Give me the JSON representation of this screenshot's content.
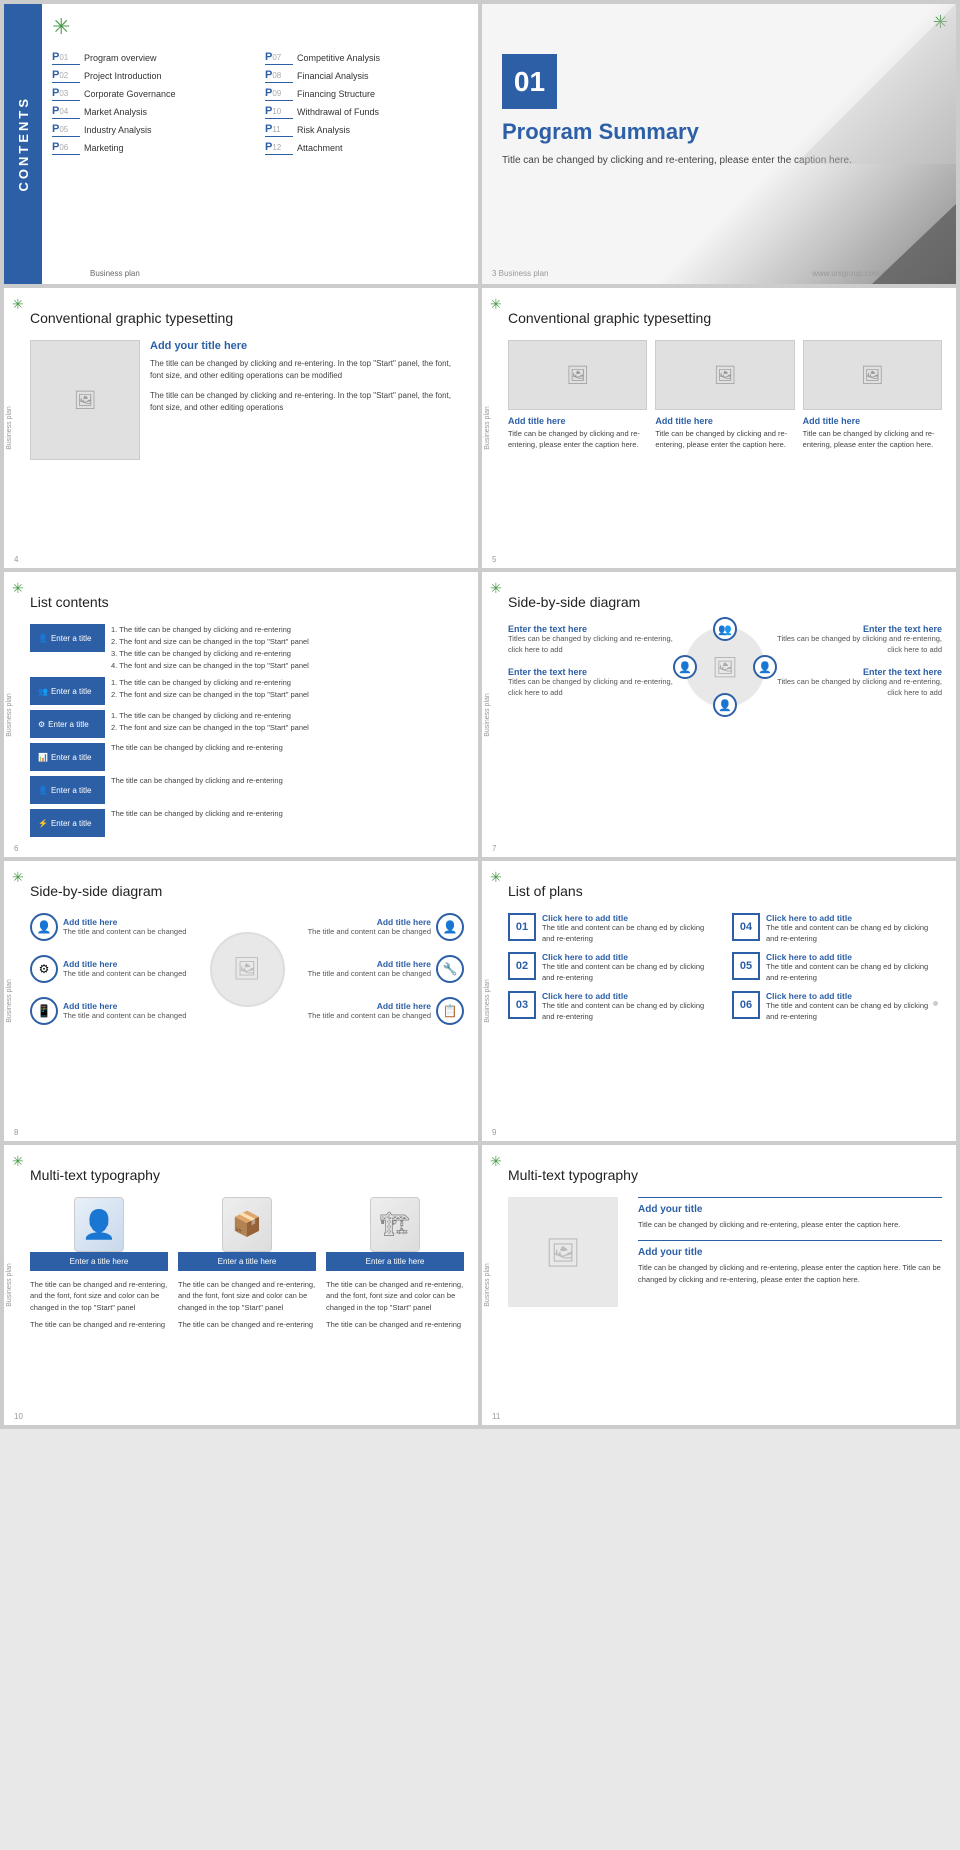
{
  "slides": {
    "contents": {
      "sidebar_label": "CONTENTS",
      "logo": "✳",
      "items": [
        {
          "num": "P01",
          "label": "Program overview"
        },
        {
          "num": "P07",
          "label": "Competitive Analysis"
        },
        {
          "num": "P02",
          "label": "Project Introduction"
        },
        {
          "num": "P08",
          "label": "Financial Analysis"
        },
        {
          "num": "P03",
          "label": "Corporate Governance"
        },
        {
          "num": "P09",
          "label": "Financing Structure"
        },
        {
          "num": "P04",
          "label": "Market Analysis"
        },
        {
          "num": "P10",
          "label": "Withdrawal of Funds"
        },
        {
          "num": "P05",
          "label": "Industry Analysis"
        },
        {
          "num": "P11",
          "label": "Risk Analysis"
        },
        {
          "num": "P06",
          "label": "Marketing"
        },
        {
          "num": "P12",
          "label": "Attachment"
        }
      ],
      "footer": "Business plan"
    },
    "summary": {
      "logo": "✳",
      "num": "01",
      "title": "Program Summary",
      "desc": "Title can be changed by clicking and re-entering, please enter the caption here.",
      "footer_left": "3  Business plan",
      "footer_right": "www.unigroup.com theme information"
    },
    "cgt_left": {
      "title": "Conventional graphic typesetting",
      "heading": "Add your title here",
      "body1": "The title can be changed by clicking and re-entering. In the top \"Start\" panel, the font, font size, and other editing operations can be modified",
      "body2": "The title can be changed by clicking and re-entering. In the top \"Start\" panel, the font, font size, and other editing operations",
      "page_num": "4",
      "side_label": "Business plan"
    },
    "cgt_right": {
      "title": "Conventional graphic typesetting",
      "cols": [
        {
          "heading": "Add title here",
          "body": "Title can be changed by clicking and re-entering, please enter the caption here."
        },
        {
          "heading": "Add title here",
          "body": "Title can be changed by clicking and re-entering, please enter the caption here."
        },
        {
          "heading": "Add title here",
          "body": "Title can be changed by clicking and re-entering, please enter the caption here."
        }
      ],
      "page_num": "5",
      "side_label": "Business plan"
    },
    "list_contents": {
      "title": "List contents",
      "items": [
        {
          "icon": "👤",
          "label": "Enter a title",
          "bullet_items": [
            "The title can be changed by clicking and re-entering",
            "The font and size can be changed in the top \"Start\" panel",
            "The title can be changed by clicking and re-entering",
            "The font and size can be changed in the top \"Start\" panel"
          ]
        },
        {
          "icon": "👥",
          "label": "Enter a title",
          "bullet_items": [
            "The title can be changed by clicking and re-entering",
            "The font and size can be changed in the top \"Start\" panel"
          ]
        },
        {
          "icon": "⚙",
          "label": "Enter a title",
          "bullet_items": [
            "The title can be changed by clicking and re-entering",
            "The font and size can be changed in the top \"Start\" panel"
          ]
        },
        {
          "icon": "📊",
          "label": "Enter a title",
          "simple_text": "The title can be changed by clicking and re-entering"
        },
        {
          "icon": "👤",
          "label": "Enter a title",
          "simple_text": "The title can be changed by clicking and re-entering"
        },
        {
          "icon": "⚡",
          "label": "Enter a title",
          "simple_text": "The title can be changed by clicking and re-entering"
        }
      ],
      "page_num": "6",
      "side_label": "Business plan"
    },
    "sbs_left": {
      "title": "Side-by-side diagram",
      "items": [
        {
          "icon": "👥",
          "title": "Enter the text here",
          "desc": "Titles can be changed by clicking and re-entering, click here to add"
        },
        {
          "icon": "👤",
          "title": "Enter the text here",
          "desc": "Titles can be changed by clicking and re-entering, click here to add"
        },
        {
          "icon": "👤",
          "title": "Enter the text here",
          "desc": "Titles can be changed by clicking and re-entering, click here to add"
        },
        {
          "icon": "👤",
          "title": "Enter the text here",
          "desc": "Titles can be changed by clicking and re-entering, click here to add"
        }
      ],
      "page_num": "7",
      "side_label": "Business plan"
    },
    "sbs_right": {
      "title": "Side-by-side diagram",
      "left_items": [
        {
          "title": "Add title here",
          "desc": "The title and content can be changed"
        },
        {
          "title": "Add title here",
          "desc": "The title and content can be changed"
        },
        {
          "title": "Add title here",
          "desc": "The title and content can be changed"
        }
      ],
      "right_items": [
        {
          "title": "Add title here",
          "desc": "The title and content can be changed"
        },
        {
          "title": "Add title here",
          "desc": "The title and content can be changed"
        },
        {
          "title": "Add title here",
          "desc": "The title and content can be changed"
        }
      ],
      "page_num": "8",
      "side_label": "Business plan"
    },
    "list_plans": {
      "title": "List of plans",
      "items": [
        {
          "num": "01",
          "title": "Click here to add title",
          "desc": "The title and content can be chang ed by clicking and re-entering"
        },
        {
          "num": "02",
          "title": "Click here to add title",
          "desc": "The title and content can be chang ed by clicking and re-entering"
        },
        {
          "num": "03",
          "title": "Click here to add title",
          "desc": "The title and content can be chang ed by clicking and re-entering"
        },
        {
          "num": "04",
          "title": "Click here to add title",
          "desc": "The title and content can be chang ed by clicking and re-entering"
        },
        {
          "num": "05",
          "title": "Click here to add title",
          "desc": "The title and content can be chang ed by clicking and re-entering"
        },
        {
          "num": "06",
          "title": "Click here to add title",
          "desc": "The title and content can be chang ed by clicking and re-entering"
        }
      ],
      "page_num": "9",
      "side_label": "Business plan"
    },
    "mtt_left": {
      "title": "Multi-text typography",
      "cols": [
        {
          "icon": "👤",
          "title": "Enter a title here",
          "body1": "The title can be changed and re-entering, and the font, font size and color can be changed in the top \"Start\" panel",
          "body2": "The title can be changed and re-entering"
        },
        {
          "icon": "📦",
          "title": "Enter a title here",
          "body1": "The title can be changed and re-entering, and the font, font size and color can be changed in the top \"Start\" panel",
          "body2": "The title can be changed and re-entering"
        },
        {
          "icon": "🏗",
          "title": "Enter a title here",
          "body1": "The title can be changed and re-entering, and the font, font size and color can be changed in the top \"Start\" panel",
          "body2": "The title can be changed and re-entering"
        }
      ],
      "page_num": "10",
      "side_label": "Business plan"
    },
    "mtt_right": {
      "title": "Multi-text typography",
      "sections": [
        {
          "heading": "Add your title",
          "body": "Title can be changed by clicking and re-entering, please enter the caption here."
        },
        {
          "heading": "Add your title",
          "body": "Title can be changed by clicking and re-entering, please enter the caption here. Title can be changed by clicking and re-entering, please enter the caption here."
        }
      ],
      "page_num": "11",
      "side_label": "Business plan"
    }
  },
  "colors": {
    "blue": "#2d5fa6",
    "green": "#4a9a4a",
    "light_gray": "#e8e8e8",
    "text_dark": "#222",
    "text_mid": "#444",
    "text_light": "#999"
  },
  "icons": {
    "snowflake": "✳",
    "image": "🖼",
    "person": "👤",
    "people": "👥",
    "gear": "⚙",
    "chart": "📊",
    "bolt": "⚡"
  }
}
